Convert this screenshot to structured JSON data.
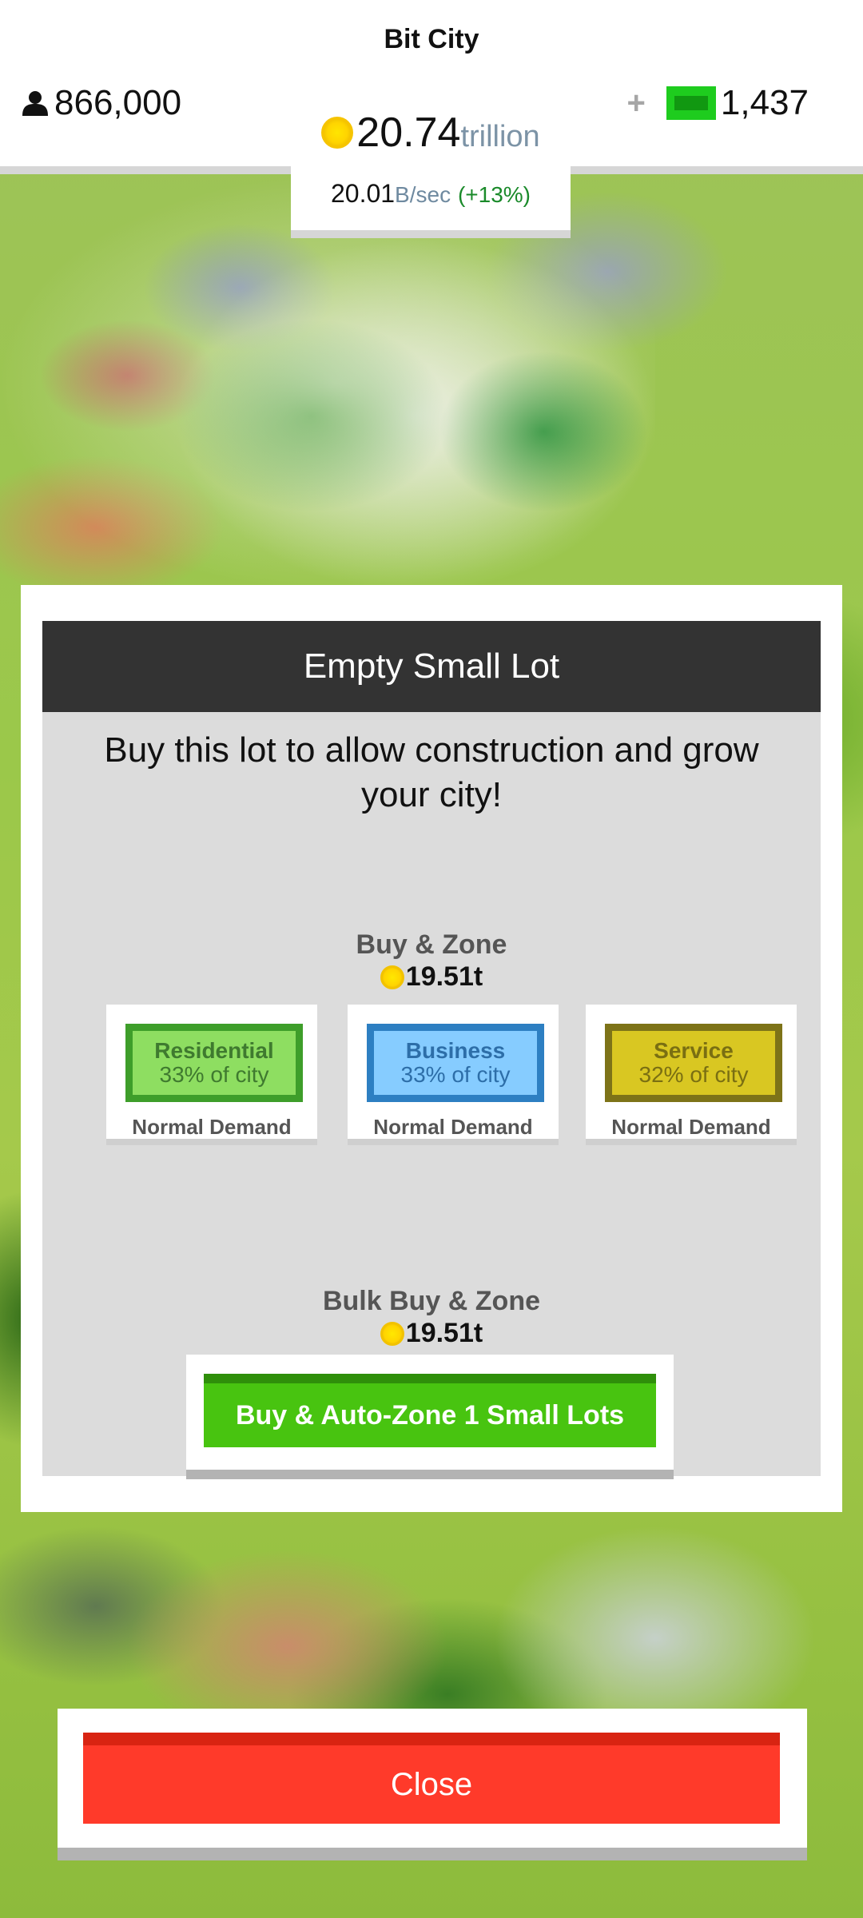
{
  "app": {
    "title": "Bit City"
  },
  "hud": {
    "population": "866,000",
    "bucks": "1,437",
    "plus_symbol": "+",
    "coins": {
      "value": "20.74",
      "unit": "trillion"
    },
    "rate": {
      "value": "20.01",
      "unit": "B/sec",
      "bonus": "(+13%)"
    }
  },
  "modal": {
    "title": "Empty Small Lot",
    "description": "Buy this lot to allow construction and grow your city!",
    "buy_zone": {
      "label": "Buy & Zone",
      "price": "19.51t"
    },
    "zones": [
      {
        "name": "Residential",
        "share": "33% of city",
        "demand": "Normal Demand",
        "color": "#8ede61"
      },
      {
        "name": "Business",
        "share": "33% of city",
        "demand": "Normal Demand",
        "color": "#86ccff"
      },
      {
        "name": "Service",
        "share": "32% of city",
        "demand": "Normal Demand",
        "color": "#d9c722"
      }
    ],
    "bulk": {
      "label": "Bulk Buy & Zone",
      "price": "19.51t",
      "button": "Buy & Auto-Zone 1 Small Lots"
    }
  },
  "close": {
    "label": "Close"
  },
  "icons": {
    "population": "person-icon",
    "coin": "coin-icon",
    "bucks": "cash-icon",
    "plus": "plus-icon"
  },
  "colors": {
    "close": "#ff3a2a",
    "bulk_button": "#48c410",
    "header": "#333333"
  }
}
